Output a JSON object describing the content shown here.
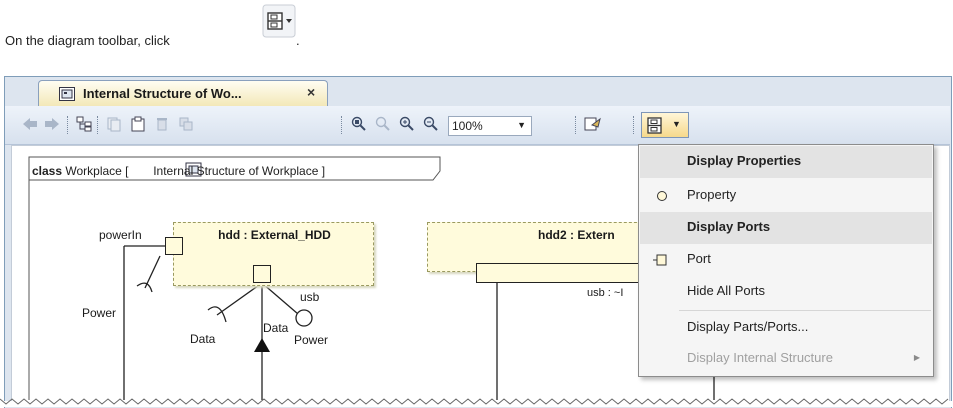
{
  "instruction": {
    "text": "On the diagram toolbar, click",
    "period": "."
  },
  "tab": {
    "title": "Internal Structure of Wo...",
    "close": "×"
  },
  "toolbar": {
    "icons": [
      "back-icon",
      "forward-icon",
      "tree-icon",
      "copy-icon",
      "paste-icon",
      "delete-icon",
      "delete-all-icon",
      "zoom-icon",
      "zoom-area-icon",
      "zoom-in-icon",
      "zoom-out-icon",
      "export-icon",
      "display-icon"
    ],
    "zoom_value": "100%",
    "zoom_arrow": "▼",
    "display_arrow": "▼"
  },
  "diagram": {
    "frame_keyword": "class",
    "frame_name": "Workplace [",
    "frame_diagram": "Internal Structure of Workplace ]",
    "part1": {
      "title": "hdd : External_HDD"
    },
    "part2": {
      "title": "hdd2 : Extern"
    },
    "labels": {
      "powerIn": "powerIn",
      "power_left": "Power",
      "usb": "usb",
      "data_left": "Data",
      "data_mid": "Data",
      "power_mid": "Power",
      "usb2": "usb : ~I"
    }
  },
  "menu": {
    "items": [
      {
        "label": "Display Properties",
        "type": "header"
      },
      {
        "label": "Property",
        "type": "item",
        "icon": "property-circle-icon"
      },
      {
        "label": "Display Ports",
        "type": "header"
      },
      {
        "label": "Port",
        "type": "item",
        "icon": "port-icon"
      },
      {
        "label": "Hide All Ports",
        "type": "item"
      },
      {
        "label": "Display Parts/Ports...",
        "type": "item"
      },
      {
        "label": "Display Internal Structure",
        "type": "disabled",
        "submenu": "▶"
      }
    ]
  },
  "colors": {
    "accent": "#f6d98c",
    "part_fill": "#fffbdc",
    "menu_header": "#e3e3e3"
  }
}
